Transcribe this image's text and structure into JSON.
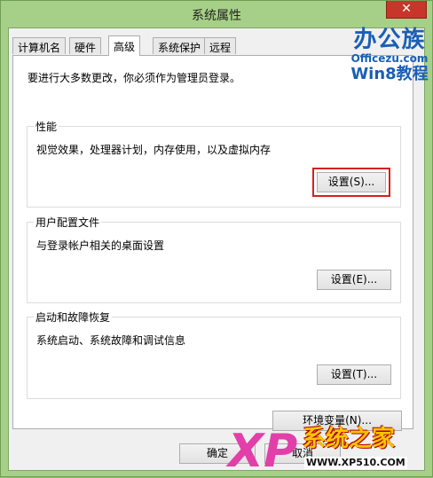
{
  "window": {
    "title": "系统属性",
    "close_glyph": "✕"
  },
  "tabs": [
    {
      "label": "计算机名"
    },
    {
      "label": "硬件"
    },
    {
      "label": "高级",
      "active": true
    },
    {
      "label": "系统保护"
    },
    {
      "label": "远程"
    }
  ],
  "advanced": {
    "admin_note": "要进行大多数更改，你必须作为管理员登录。",
    "performance": {
      "title": "性能",
      "description": "视觉效果，处理器计划，内存使用，以及虚拟内存",
      "button": "设置(S)..."
    },
    "user_profiles": {
      "title": "用户配置文件",
      "description": "与登录帐户相关的桌面设置",
      "button": "设置(E)..."
    },
    "startup_recovery": {
      "title": "启动和故障恢复",
      "description": "系统启动、系统故障和调试信息",
      "button": "设置(T)..."
    },
    "env_button": "环境变量(N)..."
  },
  "footer": {
    "ok": "确定",
    "cancel": "取消"
  },
  "watermarks": {
    "top": {
      "line1": "办公族",
      "line2": "Officezu.com",
      "line3": "Win8教程"
    },
    "bottom": {
      "mark": "XP",
      "brand": "系统之家",
      "url": "WWW.XP510.COM"
    }
  },
  "colors": {
    "highlight": "#d81e1e",
    "frame": "#a6d087",
    "close": "#c7352b"
  }
}
